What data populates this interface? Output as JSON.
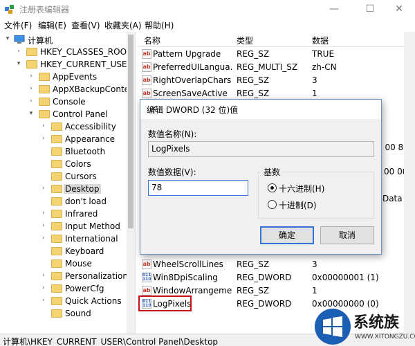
{
  "window": {
    "title": "注册表编辑器",
    "minimize_glyph": "—",
    "maximize_glyph": "☐",
    "close_glyph": "✕"
  },
  "menu": [
    "文件(F)",
    "编辑(E)",
    "查看(V)",
    "收藏夹(A)",
    "帮助(H)"
  ],
  "tree": {
    "items": [
      {
        "label": "计算机",
        "arrow": "▾"
      },
      {
        "label": "HKEY_CLASSES_ROOT",
        "arrow": "›"
      },
      {
        "label": "HKEY_CURRENT_USER",
        "arrow": "▾"
      },
      {
        "label": "AppEvents",
        "arrow": "›"
      },
      {
        "label": "AppXBackupConter",
        "arrow": "›"
      },
      {
        "label": "Console",
        "arrow": "›"
      },
      {
        "label": "Control Panel",
        "arrow": "▾"
      },
      {
        "label": "Accessibility",
        "arrow": "›"
      },
      {
        "label": "Appearance",
        "arrow": "›"
      },
      {
        "label": "Bluetooth",
        "arrow": ""
      },
      {
        "label": "Colors",
        "arrow": ""
      },
      {
        "label": "Cursors",
        "arrow": ""
      },
      {
        "label": "Desktop",
        "arrow": "›"
      },
      {
        "label": "don't load",
        "arrow": ""
      },
      {
        "label": "Infrared",
        "arrow": "›"
      },
      {
        "label": "Input Method",
        "arrow": "›"
      },
      {
        "label": "International",
        "arrow": "›"
      },
      {
        "label": "Keyboard",
        "arrow": ""
      },
      {
        "label": "Mouse",
        "arrow": ""
      },
      {
        "label": "Personalization",
        "arrow": "›"
      },
      {
        "label": "PowerCfg",
        "arrow": "›"
      },
      {
        "label": "Quick Actions",
        "arrow": "›"
      },
      {
        "label": "Sound",
        "arrow": ""
      }
    ]
  },
  "list": {
    "headers": [
      "名称",
      "类型",
      "数据"
    ],
    "rows": [
      {
        "name": "Pattern Upgrade",
        "type": "REG_SZ",
        "data": "TRUE",
        "icon": "ab"
      },
      {
        "name": "PreferredUILangua...",
        "type": "REG_MULTI_SZ",
        "data": "zh-CN",
        "icon": "ab"
      },
      {
        "name": "RightOverlapChars",
        "type": "REG_SZ",
        "data": "3",
        "icon": "ab"
      },
      {
        "name": "ScreenSaveActive",
        "type": "REG_SZ",
        "data": "1",
        "icon": "ab"
      },
      {
        "name": "WheelScrollLines",
        "type": "REG_SZ",
        "data": "3",
        "icon": "ab"
      },
      {
        "name": "Win8DpiScaling",
        "type": "REG_DWORD",
        "data": "0x00000001 (1)",
        "icon": "bin"
      },
      {
        "name": "WindowArrangeme...",
        "type": "REG_SZ",
        "data": "1",
        "icon": "ab"
      },
      {
        "name": "LogPixels",
        "type": "REG_DWORD",
        "data": "0x00000000 (0)",
        "icon": "bin"
      }
    ],
    "partials": [
      "3 00 8",
      "00 00",
      "opData"
    ]
  },
  "status": "计算机\\HKEY_CURRENT_USER\\Control Panel\\Desktop",
  "dialog": {
    "title": "编辑 DWORD (32 位)值",
    "close_glyph": "✕",
    "name_label": "数值名称(N):",
    "name_value": "LogPixels",
    "data_label": "数值数据(V):",
    "data_value": "78",
    "base_label": "基数",
    "hex_label": "十六进制(H)",
    "dec_label": "十进制(D)",
    "ok_label": "确定",
    "cancel_label": "取消"
  },
  "watermark": {
    "text": "系统族",
    "url": "WWW.XITONGZU.COM"
  },
  "colors": {
    "highlight_border": "#c0101a",
    "dialog_border": "#6e90c0",
    "default_button": "#2f74d6"
  }
}
